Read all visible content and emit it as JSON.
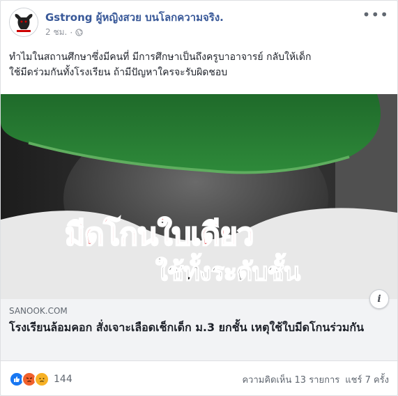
{
  "post": {
    "page_name": "Gstrong ผู้หญิงสวย บนโลกความจริง.",
    "time": "2 ชม.",
    "dot": "·",
    "text_line1": "ทำไมในสถานศึกษาซึ่งมีคนที่ มีการศึกษาเป็นถึงครูบาอาจารย์ กลับให้เด็ก",
    "text_line2": "ใช้มีดร่วมกันทั้งโรงเรียน ถ้ามีปัญหาใครจะรับผิดชอบ"
  },
  "media": {
    "overlay_line1": "มีดโกนใบเดียว",
    "overlay_line2": "ใช้ทั้งระดับชั้น",
    "info_label": "i"
  },
  "link": {
    "domain": "SANOOK.COM",
    "title": "โรงเรียนล้อมคอก สั่งเจาะเลือดเช็กเด็ก ม.3 ยกชั้น เหตุใช้ใบมีดโกนร่วมกัน"
  },
  "footer": {
    "reactions": [
      "like-icon",
      "angry-icon",
      "sad-icon"
    ],
    "reaction_count": "144",
    "comments": "ความคิดเห็น 13 รายการ",
    "shares": "แชร์ 7 ครั้ง"
  },
  "colors": {
    "page_name": "#385898",
    "overlay_red": "#d81f26",
    "like": "#1877f2"
  }
}
